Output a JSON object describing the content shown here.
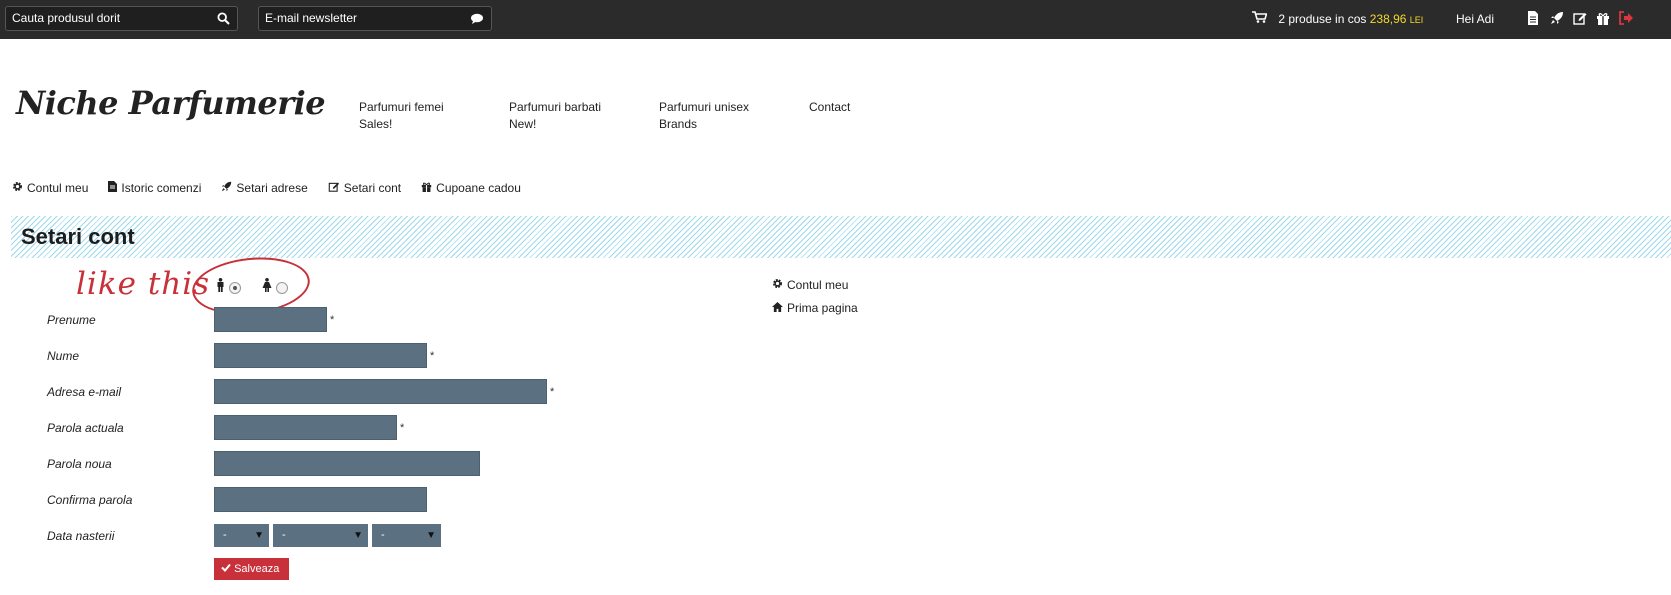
{
  "topbar": {
    "search_placeholder": "Cauta produsul dorit",
    "newsletter_placeholder": "E-mail newsletter",
    "cart_text": "2 produse in cos",
    "cart_price": "238,96",
    "cart_currency": "LEI",
    "greeting": "Hei Adi",
    "icons": [
      "document-icon",
      "rocket-icon",
      "edit-icon",
      "gift-icon",
      "logout-icon"
    ]
  },
  "header": {
    "logo": "Niche Parfumerie",
    "nav": [
      [
        "Parfumuri femei",
        "Sales!"
      ],
      [
        "Parfumuri barbati",
        "New!"
      ],
      [
        "Parfumuri unisex",
        "Brands"
      ],
      [
        "Contact"
      ]
    ]
  },
  "account_menu": [
    {
      "label": "Contul meu",
      "icon": "gear-icon"
    },
    {
      "label": "Istoric comenzi",
      "icon": "document-icon"
    },
    {
      "label": "Setari adrese",
      "icon": "rocket-icon"
    },
    {
      "label": "Setari cont",
      "icon": "edit-icon"
    },
    {
      "label": "Cupoane cadou",
      "icon": "gift-icon"
    }
  ],
  "page_title": "Setari cont",
  "annotation": "like this",
  "gender": {
    "selected": "male",
    "options": [
      "male-icon",
      "female-icon"
    ]
  },
  "form": {
    "fields": [
      {
        "label": "Prenume",
        "required": "*"
      },
      {
        "label": "Nume",
        "required": "*"
      },
      {
        "label": "Adresa e-mail",
        "required": "*"
      },
      {
        "label": "Parola actuala",
        "required": "*"
      },
      {
        "label": "Parola noua",
        "required": ""
      },
      {
        "label": "Confirma parola",
        "required": ""
      }
    ],
    "birthdate_label": "Data nasterii",
    "day_value": "-",
    "month_value": "-",
    "year_value": "-",
    "save_label": "Salveaza"
  },
  "side_links": [
    {
      "label": "Contul meu",
      "icon": "gear-icon"
    },
    {
      "label": "Prima pagina",
      "icon": "home-icon"
    }
  ],
  "colors": {
    "topbar_bg": "#2b2b2b",
    "accent": "#c8303a",
    "input_bg": "#5b7080",
    "price": "#f3d92b"
  }
}
